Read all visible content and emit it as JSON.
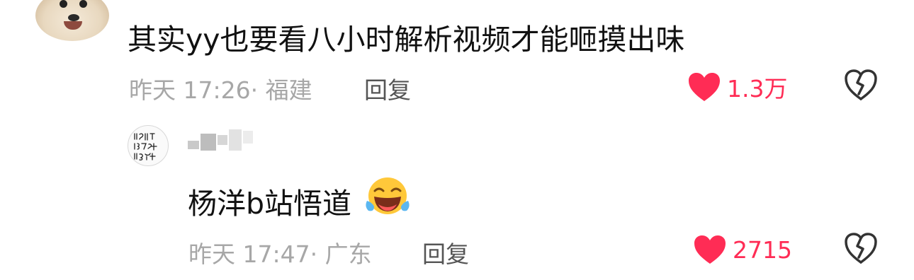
{
  "comments": [
    {
      "text": "其实yy也要看八小时解析视频才能咂摸出味",
      "time_location": "昨天 17:26· 福建",
      "reply_label": "回复",
      "likes": "1.3万",
      "avatar_icon": "dog-avatar"
    },
    {
      "text": "杨洋b站悟道",
      "emoji_icon": "laughing-crying-emoji",
      "time_location": "昨天 17:47· 广东",
      "reply_label": "回复",
      "likes": "2715",
      "avatar_icon": "handwriting-avatar"
    }
  ],
  "colors": {
    "like_red": "#ff2c55",
    "meta_gray": "#a7a7a7",
    "text_black": "#111111"
  }
}
